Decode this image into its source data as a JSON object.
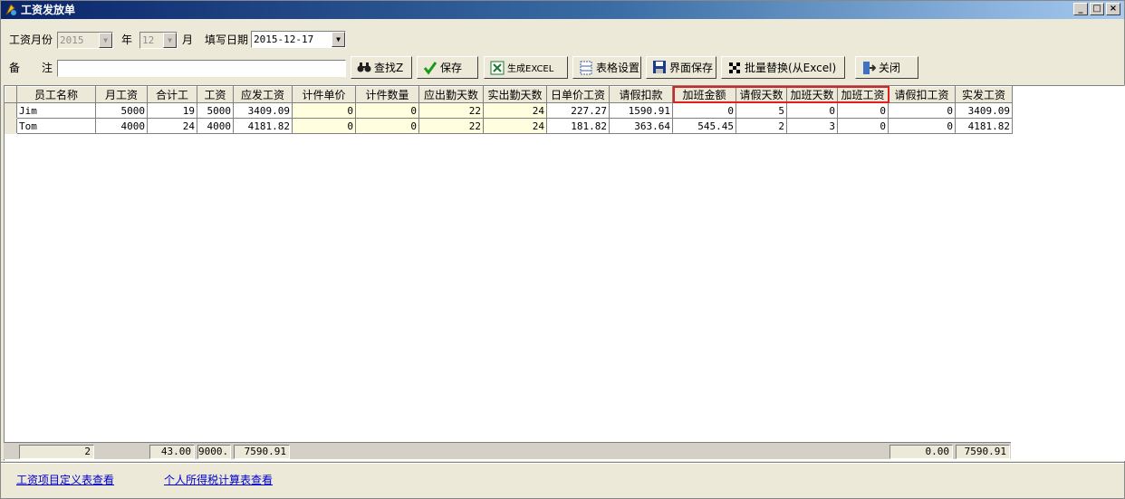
{
  "window": {
    "title": "工资发放单"
  },
  "form": {
    "month_label": "工资月份",
    "year_value": "2015",
    "year_label": "年",
    "month_value": "12",
    "month_unit_label": "月",
    "date_label": "填写日期",
    "date_value": "2015-12-17",
    "remark_label": "备　　注",
    "remark_value": ""
  },
  "toolbar": {
    "find": "查找Z",
    "save": "保存",
    "excel": "生成EXCEL",
    "table_settings": "表格设置",
    "ui_save": "界面保存",
    "batch_replace": "批量替换(从Excel)",
    "close": "关闭"
  },
  "table": {
    "columns": [
      "员工名称",
      "月工资",
      "合计工",
      "工资",
      "应发工资",
      "计件单价",
      "计件数量",
      "应出勤天数",
      "实出勤天数",
      "日单价工资",
      "请假扣款",
      "加班金额",
      "请假天数",
      "加班天数",
      "加班工资",
      "请假扣工资",
      "实发工资"
    ],
    "rows": [
      [
        "Jim",
        "5000",
        "19",
        "5000",
        "3409.09",
        "0",
        "0",
        "22",
        "24",
        "227.27",
        "1590.91",
        "0",
        "5",
        "0",
        "0",
        "0",
        "3409.09"
      ],
      [
        "Tom",
        "4000",
        "24",
        "4000",
        "4181.82",
        "0",
        "0",
        "22",
        "24",
        "181.82",
        "363.64",
        "545.45",
        "2",
        "3",
        "0",
        "0",
        "4181.82"
      ]
    ],
    "highlighted_columns": [
      "加班金额",
      "请假天数",
      "加班天数",
      "加班工资"
    ]
  },
  "totals": {
    "count": "2",
    "total_work": "43.00",
    "salary": "9000.",
    "payable": "7590.91",
    "leave_deduct": "0.00",
    "net": "7590.91"
  },
  "links": {
    "salary_items": "工资项目定义表查看",
    "income_tax": "个人所得税计算表查看"
  }
}
